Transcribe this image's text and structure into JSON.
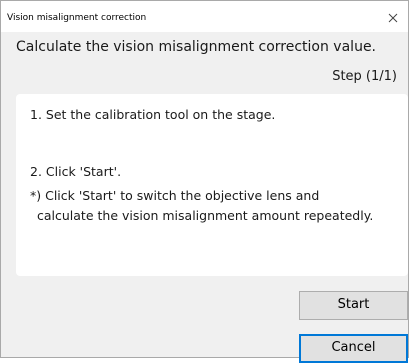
{
  "window": {
    "title": "Vision misalignment correction"
  },
  "description": "Calculate the vision misalignment correction value.",
  "step_indicator": "Step (1/1)",
  "instructions": {
    "line1": "1. Set the calibration tool on the stage.",
    "line2": "2. Click 'Start'.",
    "note_line1": "*) Click 'Start' to switch the objective lens and",
    "note_line2": "calculate the vision misalignment amount repeatedly."
  },
  "buttons": {
    "start_label": "Start",
    "cancel_label": "Cancel"
  },
  "icons": {
    "close": "close-icon"
  },
  "colors": {
    "focus_border": "#0078d7",
    "button_face": "#e1e1e1",
    "dialog_background": "#f0f0f0"
  }
}
